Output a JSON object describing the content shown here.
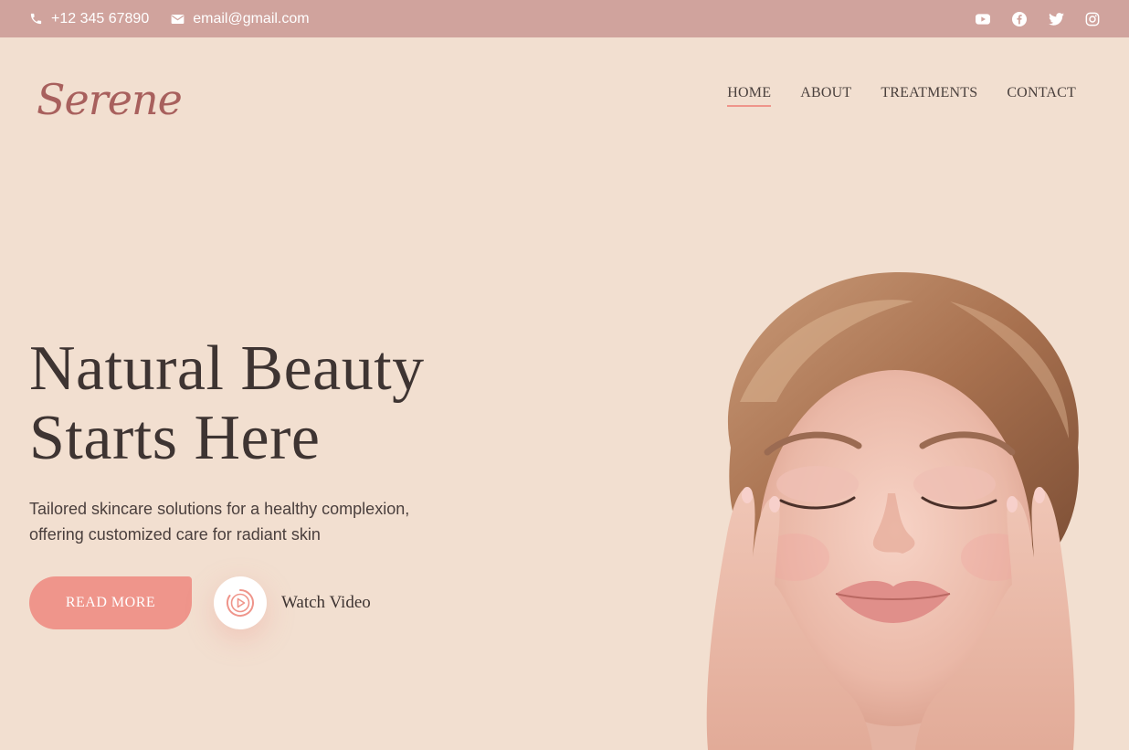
{
  "topbar": {
    "phone": "+12 345 67890",
    "email": "email@gmail.com",
    "socials": [
      "youtube-icon",
      "facebook-icon",
      "twitter-icon",
      "instagram-icon"
    ]
  },
  "brand": {
    "logo_text": "Serene"
  },
  "nav": {
    "items": [
      {
        "label": "HOME",
        "active": true
      },
      {
        "label": "ABOUT",
        "active": false
      },
      {
        "label": "TREATMENTS",
        "active": false
      },
      {
        "label": "CONTACT",
        "active": false
      }
    ]
  },
  "hero": {
    "title_line1": "Natural Beauty",
    "title_line2": "Starts Here",
    "subtitle_line1": "Tailored skincare solutions for a healthy complexion,",
    "subtitle_line2": "offering customized care for radiant skin",
    "cta_label": "READ MORE",
    "video_label": "Watch Video"
  },
  "colors": {
    "page_bg": "#f2dfd0",
    "topbar_bg": "#d0a39d",
    "accent": "#ef958b",
    "logo": "#a8605d",
    "text": "#3e3432"
  }
}
